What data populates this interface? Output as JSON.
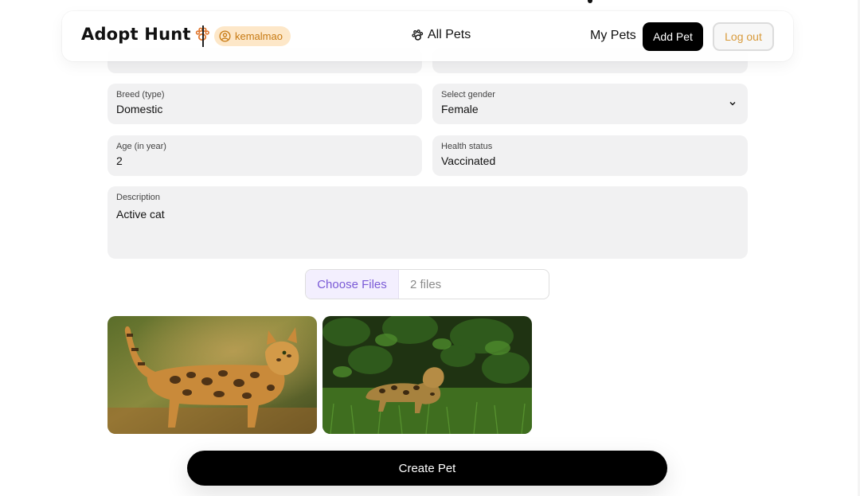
{
  "navbar": {
    "logo_text": "Adopt Hunt",
    "username": "kemalmao",
    "all_pets": "All Pets",
    "my_pets": "My Pets",
    "add_pet": "Add Pet",
    "logout": "Log out"
  },
  "form": {
    "breed": {
      "label": "Breed (type)",
      "value": "Domestic"
    },
    "gender": {
      "label": "Select gender",
      "value": "Female"
    },
    "age": {
      "label": "Age (in year)",
      "value": "2"
    },
    "health": {
      "label": "Health status",
      "value": "Vaccinated"
    },
    "description": {
      "label": "Description",
      "value": "Active cat"
    },
    "file_input": {
      "button": "Choose Files",
      "status": "2 files"
    },
    "submit": "Create Pet"
  },
  "previews": [
    {
      "name": "bengal-cat-standing"
    },
    {
      "name": "bengal-cat-grass"
    }
  ],
  "colors": {
    "accent_orange": "#c77a12",
    "badge_bg": "#fde7c8",
    "choose_files_purple": "#7a5ad6",
    "field_bg": "#f1f1f2"
  }
}
